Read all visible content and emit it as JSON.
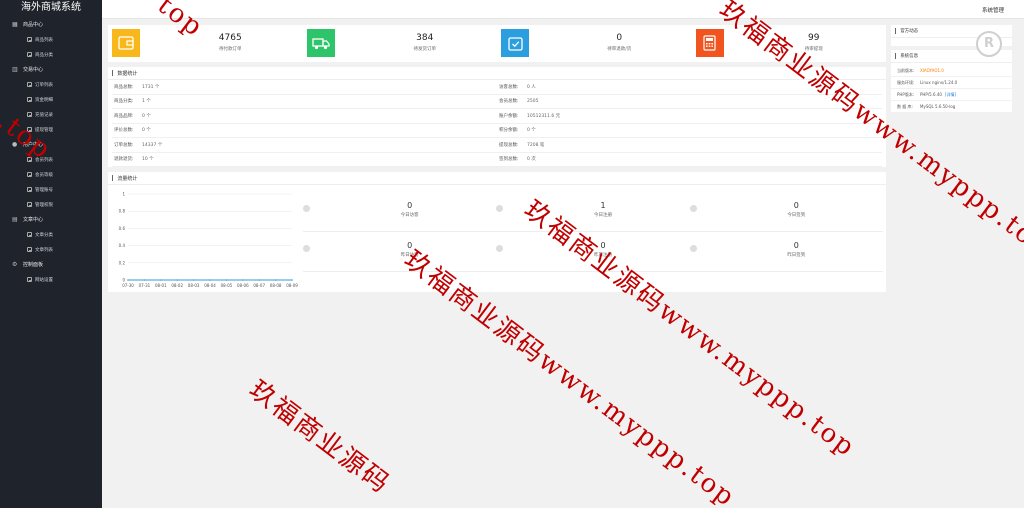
{
  "app": {
    "title": "海外商城系统"
  },
  "topbar": {
    "system_menu": "系统管理"
  },
  "sidebar": {
    "groups": [
      {
        "label": "商品中心",
        "items": [
          {
            "label": "商品列表"
          },
          {
            "label": "商品分类"
          }
        ]
      },
      {
        "label": "交易中心",
        "items": [
          {
            "label": "订单列表"
          },
          {
            "label": "资金明细"
          },
          {
            "label": "充值记录"
          },
          {
            "label": "提现管理"
          }
        ]
      },
      {
        "label": "用户中心",
        "items": [
          {
            "label": "会员列表"
          },
          {
            "label": "会员等级"
          },
          {
            "label": "管理账号"
          },
          {
            "label": "管理权限"
          }
        ]
      },
      {
        "label": "文章中心",
        "items": [
          {
            "label": "文章分类"
          },
          {
            "label": "文章列表"
          }
        ]
      },
      {
        "label": "控制面板",
        "items": [
          {
            "label": "网站设置"
          }
        ]
      }
    ]
  },
  "stats": [
    {
      "value": "4765",
      "label": "待付款订单",
      "color": "#f8b81b"
    },
    {
      "value": "384",
      "label": "待发货订单",
      "color": "#2ec46a"
    },
    {
      "value": "0",
      "label": "待审退款/货",
      "color": "#2b9ee0"
    },
    {
      "value": "99",
      "label": "待审提现",
      "color": "#f1541e"
    }
  ],
  "data_panel": {
    "title": "数据统计",
    "left": [
      {
        "key": "商品总数:",
        "value": "1731 个"
      },
      {
        "key": "商品分类:",
        "value": "1 个"
      },
      {
        "key": "商品品牌:",
        "value": "0 个"
      },
      {
        "key": "评价总数:",
        "value": "0 个"
      },
      {
        "key": "订单总数:",
        "value": "14337 个"
      },
      {
        "key": "退款退货:",
        "value": "10 个"
      }
    ],
    "right": [
      {
        "key": "访客总数:",
        "value": "0 人"
      },
      {
        "key": "会员总数:",
        "value": "2505"
      },
      {
        "key": "账户余额:",
        "value": "10512311.6 元"
      },
      {
        "key": "积分余额:",
        "value": "0 个"
      },
      {
        "key": "提现总数:",
        "value": "7208 笔"
      },
      {
        "key": "签到总数:",
        "value": "0 次"
      }
    ]
  },
  "traffic_panel": {
    "title": "流量统计",
    "cells": [
      {
        "value": "0",
        "label": "今日访客"
      },
      {
        "value": "1",
        "label": "今日注册"
      },
      {
        "value": "0",
        "label": "今日签到"
      },
      {
        "value": "0",
        "label": "昨日访客"
      },
      {
        "value": "0",
        "label": "昨日注册"
      },
      {
        "value": "0",
        "label": "昨日签到"
      }
    ]
  },
  "chart_data": {
    "type": "line",
    "categories": [
      "07-30",
      "07-31",
      "08-01",
      "08-02",
      "08-03",
      "08-04",
      "08-05",
      "08-06",
      "08-07",
      "08-08",
      "08-09"
    ],
    "series": [
      {
        "values": [
          0,
          0,
          0,
          0,
          0,
          0,
          0,
          0,
          0,
          0,
          0
        ]
      }
    ],
    "ylim": [
      0,
      1
    ],
    "yticks": [
      "0",
      "0.2",
      "0.4",
      "0.6",
      "0.8",
      "1"
    ],
    "grid": true,
    "line_color": "#2b9ee0"
  },
  "right": {
    "news_title": "官方动态",
    "info_title": "系统信息",
    "info": [
      {
        "key": "当前版本:",
        "value": "XIAOYAO1.0"
      },
      {
        "key": "服务环境:",
        "value": "Linux nginx/1.24.0"
      },
      {
        "key": "PHP版本:",
        "value": "PHP/5.6.40",
        "link": "[详情]"
      },
      {
        "key": "数 据 库:",
        "value": "MySQL 5.6.50-log"
      }
    ]
  },
  "watermark": {
    "texts": [
      "玖福商业源码www.myppp.top",
      "玖福商业源码www.myppp.top",
      "玖福商业源码www.myppp.top",
      "玖福商业源码",
      "p.top",
      "top",
      "www.myppp.t"
    ]
  }
}
